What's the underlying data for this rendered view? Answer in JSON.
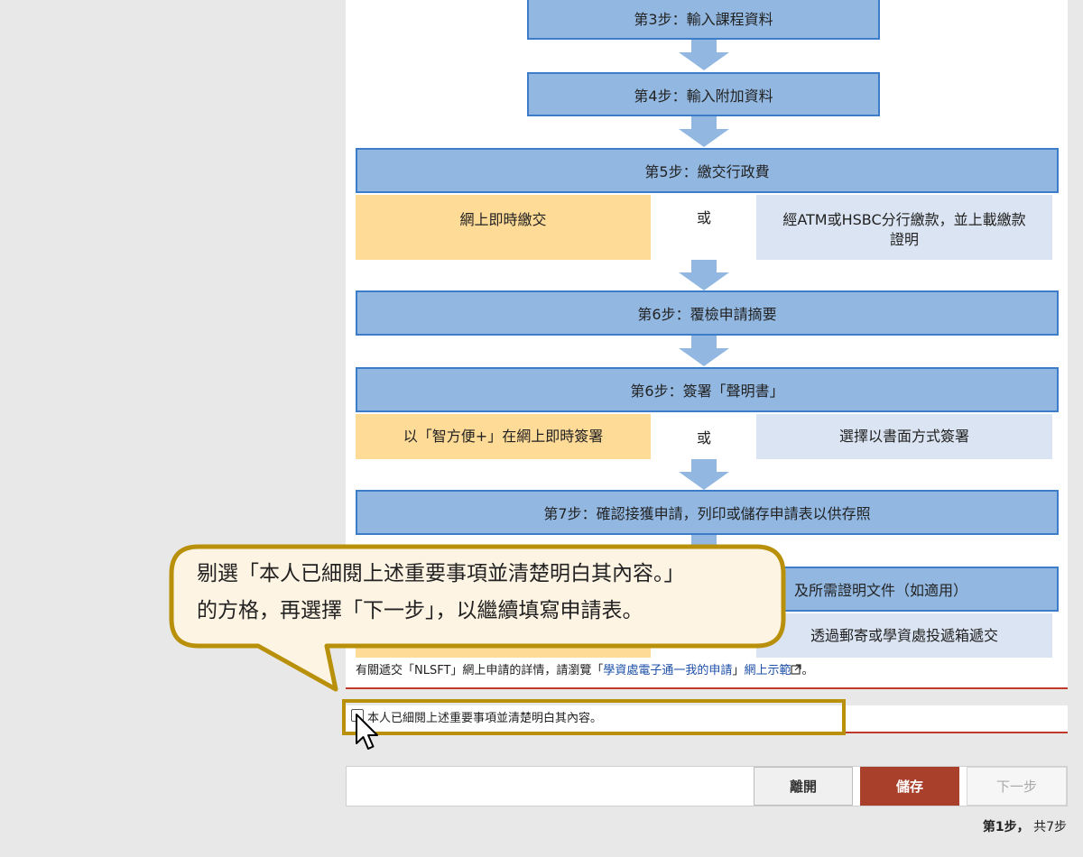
{
  "flow": {
    "step3": "第3步：輸入課程資料",
    "step4": "第4步：輸入附加資料",
    "step5": "第5步：繳交行政費",
    "step5_option_a": "網上即時繳交",
    "step5_or": "或",
    "step5_option_b_line1": "經ATM或HSBC分行繳款，並上載繳款",
    "step5_option_b_line2": "證明",
    "step6a": "第6步：覆檢申請摘要",
    "step6b": "第6步：簽署「聲明書」",
    "step6b_option_a": "以「智方便+」在網上即時簽署",
    "step6b_or": "或",
    "step6b_option_b": "選擇以書面方式簽署",
    "step7": "第7步：確認接獲申請，列印或儲存申請表以供存照",
    "step8_partial": "及所需證明文件（如適用）",
    "step8_option_b": "透過郵寄或學資處投遞箱遞交"
  },
  "info": {
    "prefix": "有關遞交「NLSFT」網上申請的詳情，請瀏覽「",
    "link_text": "學資處電子通一我的申請",
    "middle": "」",
    "link2_text": "網上示範",
    "suffix": "。"
  },
  "declaration": {
    "label": "本人已細閱上述重要事項並清楚明白其內容。",
    "checked": false
  },
  "actions": {
    "leave": "離開",
    "save": "儲存",
    "next": "下一步"
  },
  "progress": {
    "current": "第1步",
    "separator": "，",
    "total": "共7步"
  },
  "callout": {
    "line1": "剔選「本人已細閱上述重要事項並清楚明白其內容。」",
    "line2": "的方格，再選擇「下一步」，以繼續填寫申請表。"
  },
  "colors": {
    "step_fill": "#92b8e2",
    "step_border": "#3d7cc9",
    "option_yellow": "#ffdb98",
    "option_blue": "#dbe4f2",
    "save_button": "#a8402c",
    "highlight": "#b8900a",
    "callout_fill": "#fef4e3"
  }
}
